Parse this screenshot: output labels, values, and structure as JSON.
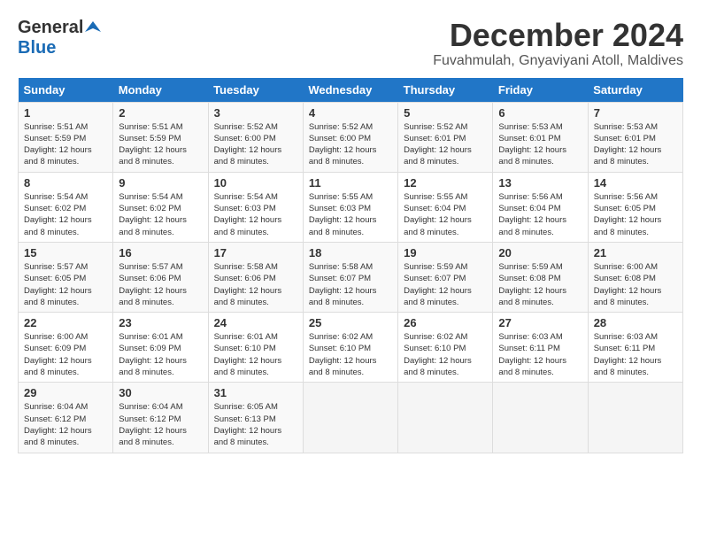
{
  "header": {
    "logo_general": "General",
    "logo_blue": "Blue",
    "month": "December 2024",
    "location": "Fuvahmulah, Gnyaviyani Atoll, Maldives"
  },
  "days_of_week": [
    "Sunday",
    "Monday",
    "Tuesday",
    "Wednesday",
    "Thursday",
    "Friday",
    "Saturday"
  ],
  "weeks": [
    [
      {
        "day": "1",
        "sunrise": "Sunrise: 5:51 AM",
        "sunset": "Sunset: 5:59 PM",
        "daylight": "Daylight: 12 hours and 8 minutes."
      },
      {
        "day": "2",
        "sunrise": "Sunrise: 5:51 AM",
        "sunset": "Sunset: 5:59 PM",
        "daylight": "Daylight: 12 hours and 8 minutes."
      },
      {
        "day": "3",
        "sunrise": "Sunrise: 5:52 AM",
        "sunset": "Sunset: 6:00 PM",
        "daylight": "Daylight: 12 hours and 8 minutes."
      },
      {
        "day": "4",
        "sunrise": "Sunrise: 5:52 AM",
        "sunset": "Sunset: 6:00 PM",
        "daylight": "Daylight: 12 hours and 8 minutes."
      },
      {
        "day": "5",
        "sunrise": "Sunrise: 5:52 AM",
        "sunset": "Sunset: 6:01 PM",
        "daylight": "Daylight: 12 hours and 8 minutes."
      },
      {
        "day": "6",
        "sunrise": "Sunrise: 5:53 AM",
        "sunset": "Sunset: 6:01 PM",
        "daylight": "Daylight: 12 hours and 8 minutes."
      },
      {
        "day": "7",
        "sunrise": "Sunrise: 5:53 AM",
        "sunset": "Sunset: 6:01 PM",
        "daylight": "Daylight: 12 hours and 8 minutes."
      }
    ],
    [
      {
        "day": "8",
        "sunrise": "Sunrise: 5:54 AM",
        "sunset": "Sunset: 6:02 PM",
        "daylight": "Daylight: 12 hours and 8 minutes."
      },
      {
        "day": "9",
        "sunrise": "Sunrise: 5:54 AM",
        "sunset": "Sunset: 6:02 PM",
        "daylight": "Daylight: 12 hours and 8 minutes."
      },
      {
        "day": "10",
        "sunrise": "Sunrise: 5:54 AM",
        "sunset": "Sunset: 6:03 PM",
        "daylight": "Daylight: 12 hours and 8 minutes."
      },
      {
        "day": "11",
        "sunrise": "Sunrise: 5:55 AM",
        "sunset": "Sunset: 6:03 PM",
        "daylight": "Daylight: 12 hours and 8 minutes."
      },
      {
        "day": "12",
        "sunrise": "Sunrise: 5:55 AM",
        "sunset": "Sunset: 6:04 PM",
        "daylight": "Daylight: 12 hours and 8 minutes."
      },
      {
        "day": "13",
        "sunrise": "Sunrise: 5:56 AM",
        "sunset": "Sunset: 6:04 PM",
        "daylight": "Daylight: 12 hours and 8 minutes."
      },
      {
        "day": "14",
        "sunrise": "Sunrise: 5:56 AM",
        "sunset": "Sunset: 6:05 PM",
        "daylight": "Daylight: 12 hours and 8 minutes."
      }
    ],
    [
      {
        "day": "15",
        "sunrise": "Sunrise: 5:57 AM",
        "sunset": "Sunset: 6:05 PM",
        "daylight": "Daylight: 12 hours and 8 minutes."
      },
      {
        "day": "16",
        "sunrise": "Sunrise: 5:57 AM",
        "sunset": "Sunset: 6:06 PM",
        "daylight": "Daylight: 12 hours and 8 minutes."
      },
      {
        "day": "17",
        "sunrise": "Sunrise: 5:58 AM",
        "sunset": "Sunset: 6:06 PM",
        "daylight": "Daylight: 12 hours and 8 minutes."
      },
      {
        "day": "18",
        "sunrise": "Sunrise: 5:58 AM",
        "sunset": "Sunset: 6:07 PM",
        "daylight": "Daylight: 12 hours and 8 minutes."
      },
      {
        "day": "19",
        "sunrise": "Sunrise: 5:59 AM",
        "sunset": "Sunset: 6:07 PM",
        "daylight": "Daylight: 12 hours and 8 minutes."
      },
      {
        "day": "20",
        "sunrise": "Sunrise: 5:59 AM",
        "sunset": "Sunset: 6:08 PM",
        "daylight": "Daylight: 12 hours and 8 minutes."
      },
      {
        "day": "21",
        "sunrise": "Sunrise: 6:00 AM",
        "sunset": "Sunset: 6:08 PM",
        "daylight": "Daylight: 12 hours and 8 minutes."
      }
    ],
    [
      {
        "day": "22",
        "sunrise": "Sunrise: 6:00 AM",
        "sunset": "Sunset: 6:09 PM",
        "daylight": "Daylight: 12 hours and 8 minutes."
      },
      {
        "day": "23",
        "sunrise": "Sunrise: 6:01 AM",
        "sunset": "Sunset: 6:09 PM",
        "daylight": "Daylight: 12 hours and 8 minutes."
      },
      {
        "day": "24",
        "sunrise": "Sunrise: 6:01 AM",
        "sunset": "Sunset: 6:10 PM",
        "daylight": "Daylight: 12 hours and 8 minutes."
      },
      {
        "day": "25",
        "sunrise": "Sunrise: 6:02 AM",
        "sunset": "Sunset: 6:10 PM",
        "daylight": "Daylight: 12 hours and 8 minutes."
      },
      {
        "day": "26",
        "sunrise": "Sunrise: 6:02 AM",
        "sunset": "Sunset: 6:10 PM",
        "daylight": "Daylight: 12 hours and 8 minutes."
      },
      {
        "day": "27",
        "sunrise": "Sunrise: 6:03 AM",
        "sunset": "Sunset: 6:11 PM",
        "daylight": "Daylight: 12 hours and 8 minutes."
      },
      {
        "day": "28",
        "sunrise": "Sunrise: 6:03 AM",
        "sunset": "Sunset: 6:11 PM",
        "daylight": "Daylight: 12 hours and 8 minutes."
      }
    ],
    [
      {
        "day": "29",
        "sunrise": "Sunrise: 6:04 AM",
        "sunset": "Sunset: 6:12 PM",
        "daylight": "Daylight: 12 hours and 8 minutes."
      },
      {
        "day": "30",
        "sunrise": "Sunrise: 6:04 AM",
        "sunset": "Sunset: 6:12 PM",
        "daylight": "Daylight: 12 hours and 8 minutes."
      },
      {
        "day": "31",
        "sunrise": "Sunrise: 6:05 AM",
        "sunset": "Sunset: 6:13 PM",
        "daylight": "Daylight: 12 hours and 8 minutes."
      },
      null,
      null,
      null,
      null
    ]
  ]
}
